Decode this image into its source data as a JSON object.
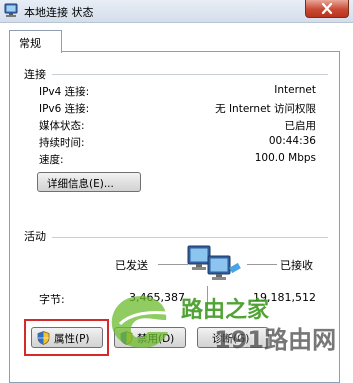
{
  "window": {
    "title": "本地连接 状态"
  },
  "tabs": [
    {
      "label": "常规"
    }
  ],
  "connection": {
    "group_label": "连接",
    "rows": [
      {
        "label": "IPv4 连接:",
        "value": "Internet"
      },
      {
        "label": "IPv6 连接:",
        "value": "无 Internet 访问权限"
      },
      {
        "label": "媒体状态:",
        "value": "已启用"
      },
      {
        "label": "持续时间:",
        "value": "00:44:36"
      },
      {
        "label": "速度:",
        "value": "100.0 Mbps"
      }
    ],
    "details_button": "详细信息(E)..."
  },
  "activity": {
    "group_label": "活动",
    "sent_label": "已发送",
    "received_label": "已接收",
    "bytes_label": "字节:",
    "bytes_sent": "3,465,387",
    "bytes_received": "19,181,512"
  },
  "buttons": {
    "properties": "属性(P)",
    "disable": "禁用(D)",
    "diagnose": "诊断(G)"
  },
  "watermark": {
    "line1": "路由之家",
    "line2": "191路由网"
  }
}
